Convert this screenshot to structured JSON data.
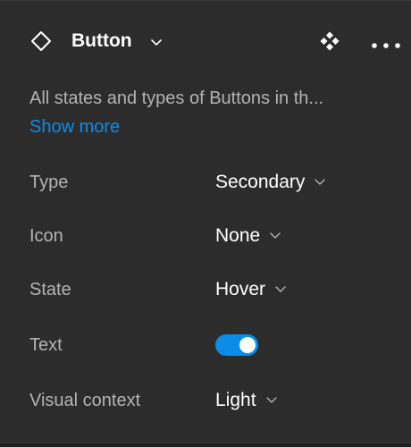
{
  "panel": {
    "title": "Button",
    "description": "All states and types of Buttons in th...",
    "show_more": "Show more"
  },
  "properties": [
    {
      "label": "Type",
      "value": "Secondary",
      "kind": "dropdown"
    },
    {
      "label": "Icon",
      "value": "None",
      "kind": "dropdown"
    },
    {
      "label": "State",
      "value": "Hover",
      "kind": "dropdown"
    },
    {
      "label": "Text",
      "value": true,
      "kind": "toggle"
    },
    {
      "label": "Visual context",
      "value": "Light",
      "kind": "dropdown"
    }
  ],
  "icons": {
    "component": "component-diamond-icon",
    "title_chevron": "chevron-down-icon",
    "variants": "variants-icon",
    "more": "more-horizontal-icon"
  },
  "colors": {
    "background": "#2c2c2c",
    "accent": "#0c8ce9",
    "label": "#b3b3b3",
    "text": "#ffffff"
  }
}
